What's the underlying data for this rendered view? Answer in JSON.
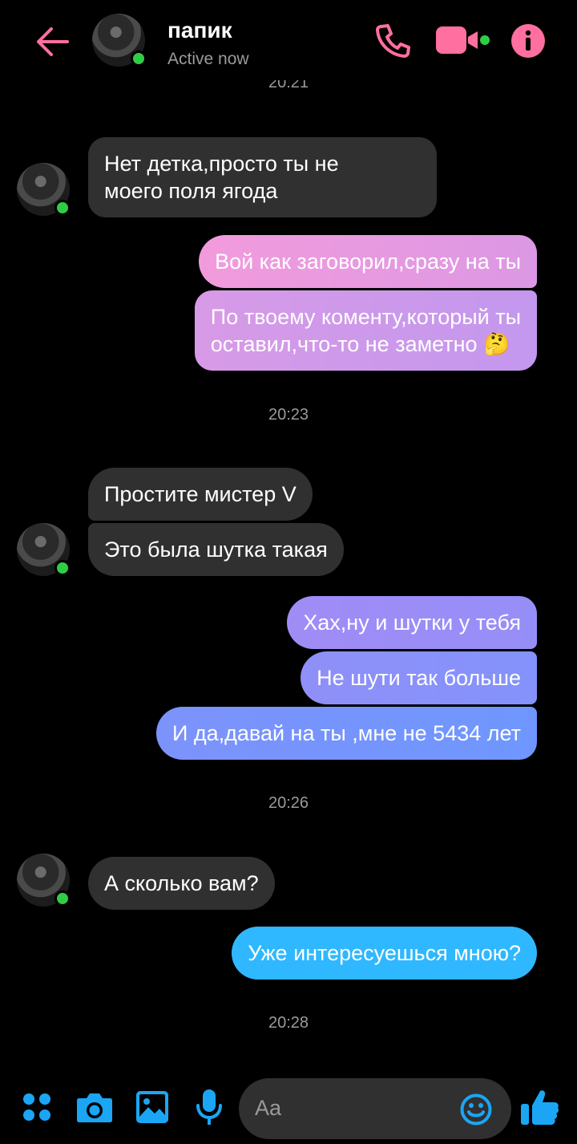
{
  "header": {
    "back_icon": "arrow-left-icon",
    "contact_name": "папик",
    "status": "Active now",
    "call_icon": "phone-icon",
    "video_icon": "video-camera-icon",
    "info_icon": "info-icon"
  },
  "timestamps": {
    "cut_top": "20:21",
    "t1": "20:23",
    "t2": "20:26",
    "t3": "20:28"
  },
  "messages": [
    {
      "from": "contact",
      "text": "Нет детка,просто ты не\nмоего поля ягода"
    },
    {
      "from": "me",
      "text": "Вой как заговорил,сразу на ты"
    },
    {
      "from": "me",
      "text": "По твоему коменту,который ты\nоставил,что-то не заметно 🤔"
    },
    {
      "from": "contact",
      "text": "Простите мистер V"
    },
    {
      "from": "contact",
      "text": "Это была шутка такая"
    },
    {
      "from": "me",
      "text": "Хах,ну и шутки у тебя"
    },
    {
      "from": "me",
      "text": "Не шути так больше"
    },
    {
      "from": "me",
      "text": "И да,давай на ты ,мне не 5434 лет"
    },
    {
      "from": "contact",
      "text": "А сколько вам?"
    },
    {
      "from": "me",
      "text": "Уже интересуешься мною?"
    }
  ],
  "composer": {
    "placeholder": "Aa",
    "menu_icon": "apps-grid-icon",
    "camera_icon": "camera-icon",
    "gallery_icon": "image-icon",
    "mic_icon": "microphone-icon",
    "emoji_icon": "smiley-icon",
    "like_icon": "thumbs-up-icon"
  },
  "colors": {
    "accent_pink": "#ff6f9f",
    "online": "#31cc46",
    "incoming_bubble": "#303030",
    "out_purple_from": "#f29bdc",
    "out_purple_to": "#c398ee",
    "out_blue_from": "#9b8cf6",
    "out_blue_to": "#6f96ff",
    "out_cyan": "#2fb8ff",
    "composer_blue": "#1ba6f5"
  }
}
